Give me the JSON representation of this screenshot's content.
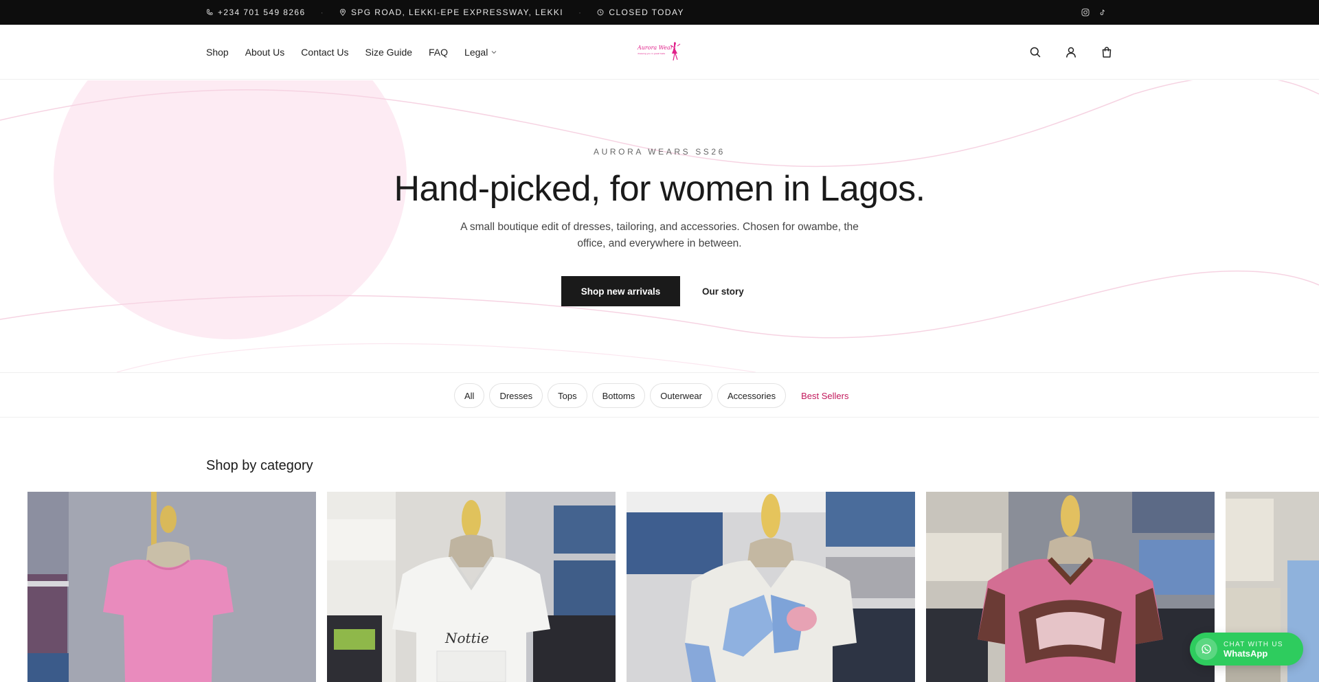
{
  "topbar": {
    "phone": "+234 701 549 8266",
    "address": "SPG ROAD, LEKKI-EPE EXPRESSWAY, LEKKI",
    "hours": "CLOSED TODAY",
    "icons": [
      "phone-icon",
      "location-pin-icon",
      "clock-icon",
      "instagram-icon",
      "tiktok-icon"
    ]
  },
  "nav": {
    "items": [
      "Shop",
      "About Us",
      "Contact Us",
      "Size Guide",
      "FAQ",
      "Legal"
    ]
  },
  "logo": {
    "text": "Aurora Wears",
    "tagline": "dressing you in great taste"
  },
  "header_icons": [
    "search-icon",
    "account-icon",
    "shopping-bag-icon"
  ],
  "hero": {
    "eyebrow": "AURORA WEARS SS26",
    "headline": "Hand-picked, for women in Lagos.",
    "subtext": "A small boutique edit of dresses, tailoring, and accessories. Chosen for owambe, the office, and everywhere in between.",
    "primary_cta": "Shop new arrivals",
    "secondary_cta": "Our story"
  },
  "filters": [
    "All",
    "Dresses",
    "Tops",
    "Bottoms",
    "Outerwear",
    "Accessories",
    "Best Sellers"
  ],
  "category": {
    "title": "Shop by category",
    "cards": [
      "pink-top-mannequin",
      "white-jersey-mannequin",
      "blue-white-jersey-mannequin",
      "pink-jersey-mannequin",
      "partial-card"
    ]
  },
  "whatsapp": {
    "small": "CHAT WITH US",
    "big": "WhatsApp"
  },
  "colors": {
    "accent": "#c2185b",
    "topbar": "#0d0d0d",
    "cta": "#1a1a1a",
    "whatsapp": "#2ecc5e",
    "blob": "#fdebf3"
  }
}
